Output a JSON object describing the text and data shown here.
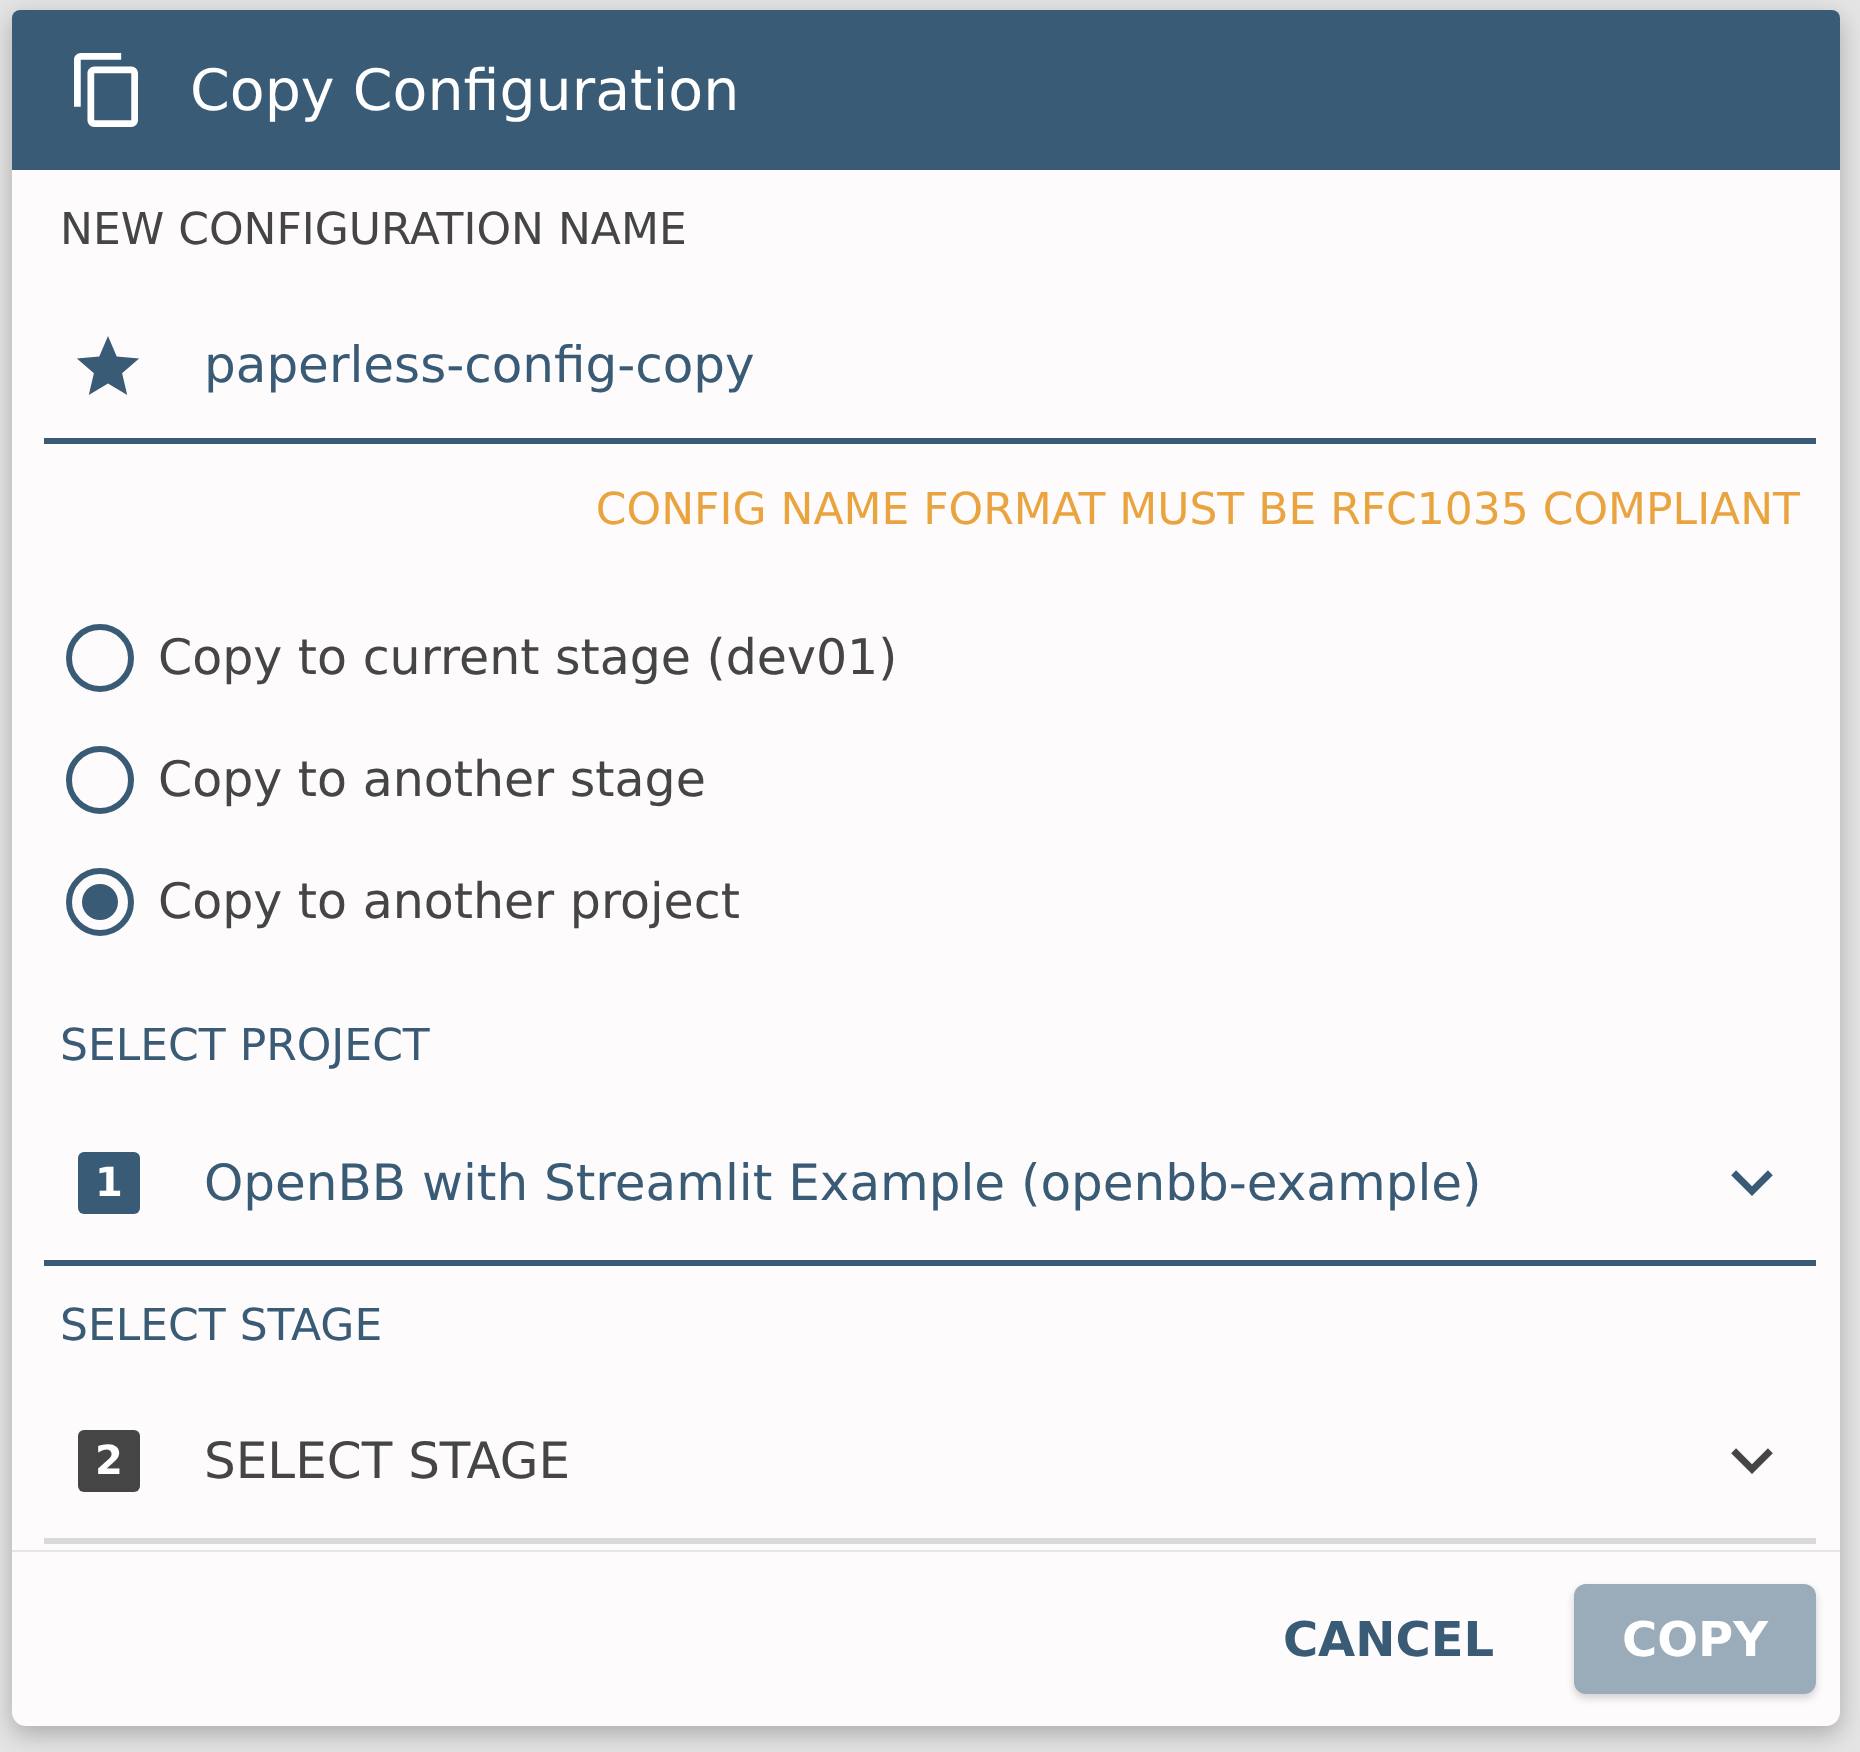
{
  "dialog": {
    "title": "Copy Configuration"
  },
  "name_field": {
    "label": "NEW CONFIGURATION NAME",
    "value": "paperless-config-copy",
    "hint": "CONFIG NAME FORMAT MUST BE RFC1035 COMPLIANT"
  },
  "copy_options": [
    {
      "label": "Copy to current stage (dev01)",
      "selected": false
    },
    {
      "label": "Copy to another stage",
      "selected": false
    },
    {
      "label": "Copy to another project",
      "selected": true
    }
  ],
  "selects": [
    {
      "label": "SELECT PROJECT",
      "step": "1",
      "value": "OpenBB with Streamlit Example (openbb-example)"
    },
    {
      "label": "SELECT STAGE",
      "step": "2",
      "placeholder": "SELECT STAGE"
    }
  ],
  "buttons": [
    {
      "label": "CANCEL",
      "kind": "text",
      "disabled": false
    },
    {
      "label": "COPY",
      "kind": "contained",
      "disabled": true
    }
  ]
}
